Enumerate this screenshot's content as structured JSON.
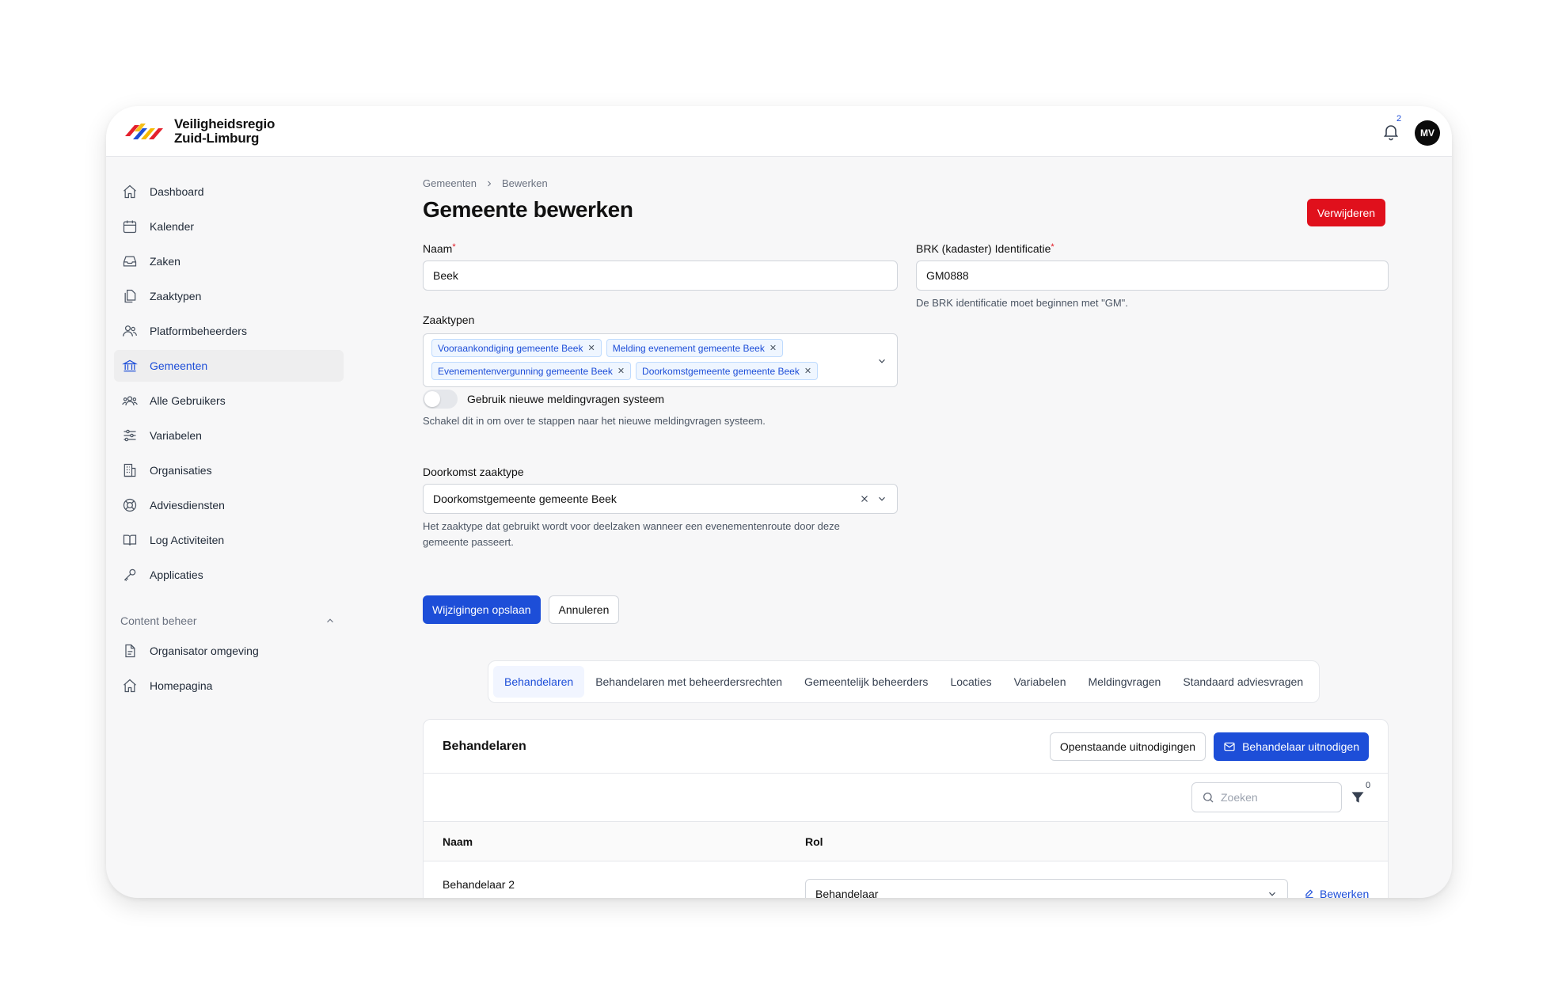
{
  "brand": {
    "line1": "Veiligheidsregio",
    "line2": "Zuid-Limburg"
  },
  "header": {
    "notification_count": "2",
    "avatar_initials": "MV"
  },
  "sidebar": {
    "items": [
      {
        "label": "Dashboard",
        "icon": "home-icon"
      },
      {
        "label": "Kalender",
        "icon": "calendar-icon"
      },
      {
        "label": "Zaken",
        "icon": "inbox-icon"
      },
      {
        "label": "Zaaktypen",
        "icon": "documents-icon"
      },
      {
        "label": "Platformbeheerders",
        "icon": "users-icon"
      },
      {
        "label": "Gemeenten",
        "icon": "bank-icon",
        "active": true
      },
      {
        "label": "Alle Gebruikers",
        "icon": "user-group-icon"
      },
      {
        "label": "Variabelen",
        "icon": "sliders-icon"
      },
      {
        "label": "Organisaties",
        "icon": "building-icon"
      },
      {
        "label": "Adviesdiensten",
        "icon": "lifebuoy-icon"
      },
      {
        "label": "Log Activiteiten",
        "icon": "book-icon"
      },
      {
        "label": "Applicaties",
        "icon": "key-icon"
      }
    ],
    "section_title": "Content beheer",
    "section_items": [
      {
        "label": "Organisator omgeving",
        "icon": "document-icon"
      },
      {
        "label": "Homepagina",
        "icon": "home-icon"
      }
    ]
  },
  "breadcrumb": {
    "parent": "Gemeenten",
    "current": "Bewerken"
  },
  "page": {
    "title": "Gemeente bewerken",
    "delete_label": "Verwijderen"
  },
  "form": {
    "name_label": "Naam",
    "name_value": "Beek",
    "brk_label": "BRK (kadaster) Identificatie",
    "brk_value": "GM0888",
    "brk_help": "De BRK identificatie moet beginnen met \"GM\".",
    "zaaktypen_label": "Zaaktypen",
    "zaaktypen_tags": [
      "Vooraankondiging gemeente Beek",
      "Melding evenement gemeente Beek",
      "Evenementenvergunning gemeente Beek",
      "Doorkomstgemeente gemeente Beek"
    ],
    "toggle_label": "Gebruik nieuwe meldingvragen systeem",
    "toggle_on": false,
    "toggle_help": "Schakel dit in om over te stappen naar het nieuwe meldingvragen systeem.",
    "doorkomst_label": "Doorkomst zaaktype",
    "doorkomst_value": "Doorkomstgemeente gemeente Beek",
    "doorkomst_help": "Het zaaktype dat gebruikt wordt voor deelzaken wanneer een evenementenroute door deze gemeente passeert.",
    "save_label": "Wijzigingen opslaan",
    "cancel_label": "Annuleren"
  },
  "tabs": [
    {
      "label": "Behandelaren",
      "active": true
    },
    {
      "label": "Behandelaren met beheerdersrechten"
    },
    {
      "label": "Gemeentelijk beheerders"
    },
    {
      "label": "Locaties"
    },
    {
      "label": "Variabelen"
    },
    {
      "label": "Meldingvragen"
    },
    {
      "label": "Standaard adviesvragen"
    }
  ],
  "card": {
    "title": "Behandelaren",
    "pending_label": "Openstaande uitnodigingen",
    "invite_label": "Behandelaar uitnodigen",
    "search_placeholder": "Zoeken",
    "filter_count": "0",
    "columns": [
      "Naam",
      "Rol"
    ],
    "rows": [
      {
        "name": "Behandelaar 2",
        "role": "Behandelaar",
        "action": "Bewerken"
      }
    ]
  },
  "colors": {
    "primary": "#1d4ed8",
    "danger": "#e0101c"
  }
}
